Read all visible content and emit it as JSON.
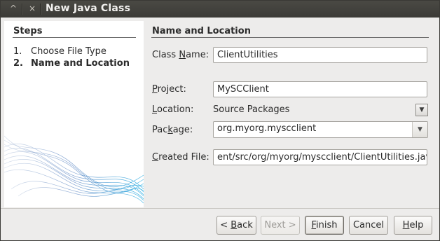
{
  "window": {
    "title": "New Java Class",
    "minimize_glyph": "^",
    "close_glyph": "×"
  },
  "steps": {
    "title": "Steps",
    "items": [
      {
        "num": "1.",
        "label": "Choose File Type"
      },
      {
        "num": "2.",
        "label": "Name and Location"
      }
    ]
  },
  "main": {
    "section_title": "Name and Location",
    "class_name": {
      "label_pre": "Class ",
      "label_key": "N",
      "label_post": "ame:",
      "value": "ClientUtilities"
    },
    "project": {
      "label_key": "P",
      "label_post": "roject:",
      "value": "MySCClient"
    },
    "location": {
      "label_key": "L",
      "label_post": "ocation:",
      "value": "Source Packages"
    },
    "package": {
      "label_pre": "Pac",
      "label_key": "k",
      "label_post": "age:",
      "value": "org.myorg.myscclient"
    },
    "created_file": {
      "label_pre": "",
      "label_key": "C",
      "label_post": "reated File:",
      "value": "ent/src/org/myorg/myscclient/ClientUtilities.java"
    }
  },
  "buttons": {
    "back": {
      "pre": "< ",
      "key": "B",
      "post": "ack"
    },
    "next": {
      "label": "Next >"
    },
    "finish": {
      "key": "F",
      "post": "inish"
    },
    "cancel": {
      "label": "Cancel"
    },
    "help": {
      "key": "H",
      "post": "elp"
    }
  },
  "icons": {
    "dropdown": "▼",
    "waves": "wave-graphic"
  }
}
